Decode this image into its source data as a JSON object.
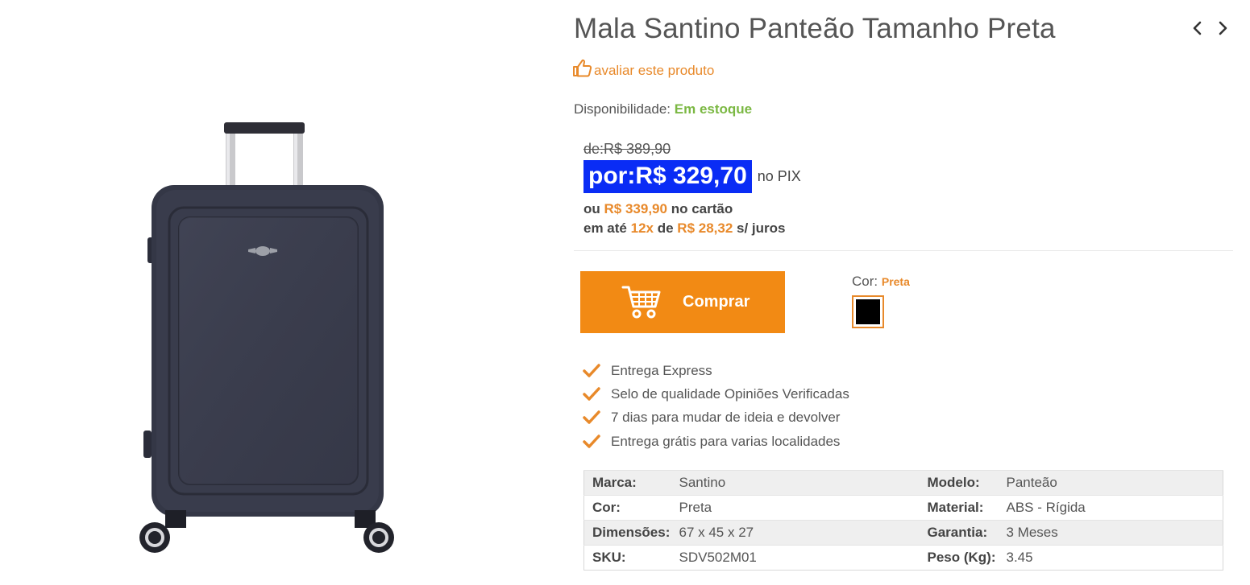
{
  "product": {
    "title": "Mala Santino Panteão Tamanho Preta",
    "review_link": "avaliar este produto",
    "availability_label": "Disponibilidade:",
    "availability_value": "Em estoque"
  },
  "pricing": {
    "old_price": "de:R$ 389,90",
    "new_price": "por:R$ 329,70",
    "pix_suffix": "no PIX",
    "card_prefix": "ou",
    "card_price": "R$ 339,90",
    "card_suffix": "no cartão",
    "installment_prefix": "em até",
    "installment_count": "12x",
    "installment_de": "de",
    "installment_value": "R$ 28,32",
    "installment_suffix": "s/ juros",
    "price_highlight_color": "#0a2cf5",
    "accent_color": "#e8892a"
  },
  "purchase": {
    "buy_label": "Comprar",
    "color_label": "Cor:",
    "color_value": "Preta",
    "swatch_color": "#000000",
    "button_color": "#f28a14"
  },
  "benefits": [
    "Entrega Express",
    "Selo de qualidade Opiniões Verificadas",
    "7 dias para mudar de ideia e devolver",
    "Entrega grátis para varias localidades"
  ],
  "specs": [
    [
      "Marca:",
      "Santino",
      "Modelo:",
      "Panteão"
    ],
    [
      "Cor:",
      "Preta",
      "Material:",
      "ABS - Rígida"
    ],
    [
      "Dimensões:",
      "67 x 45 x 27",
      "Garantia:",
      "3 Meses"
    ],
    [
      "SKU:",
      "SDV502M01",
      "Peso (Kg):",
      "3.45"
    ]
  ],
  "icons": {
    "prev": "chevron-left-icon",
    "next": "chevron-right-icon",
    "review": "thumbs-up-icon",
    "cart": "shopping-cart-icon",
    "benefit": "check-icon"
  }
}
